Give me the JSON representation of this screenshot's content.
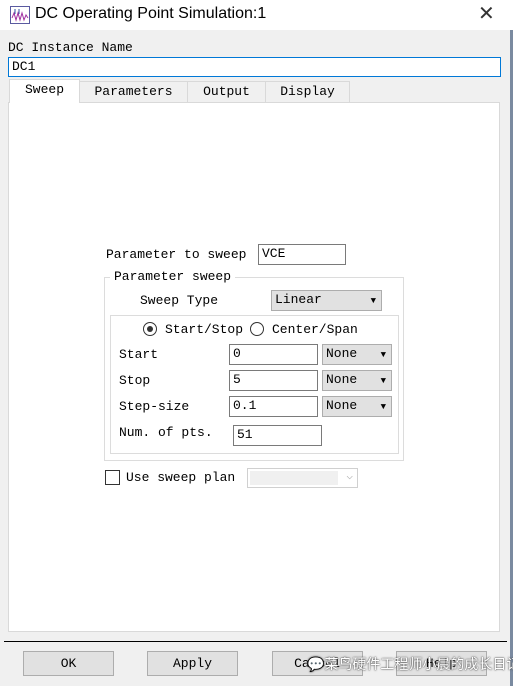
{
  "window": {
    "title": "DC Operating Point Simulation:1",
    "close_icon": "close-icon",
    "app_icon": "waveform-icon"
  },
  "instance": {
    "label": "DC Instance Name",
    "value": "DC1"
  },
  "tabs": [
    {
      "label": "Sweep",
      "selected": true
    },
    {
      "label": "Parameters"
    },
    {
      "label": "Output"
    },
    {
      "label": "Display"
    }
  ],
  "sweep": {
    "param_label": "Parameter to sweep",
    "param_value": "VCE",
    "group_label": "Parameter sweep",
    "type_label": "Sweep Type",
    "type_value": "Linear",
    "mode_options": [
      {
        "label": "Start/Stop",
        "selected": true
      },
      {
        "label": "Center/Span",
        "selected": false
      }
    ],
    "rows": [
      {
        "label": "Start",
        "value": "0",
        "unit": "None"
      },
      {
        "label": "Stop",
        "value": "5",
        "unit": "None"
      },
      {
        "label": "Step-size",
        "value": "0.1",
        "unit": "None"
      }
    ],
    "num_pts_label": "Num. of pts.",
    "num_pts_value": "51",
    "use_plan_label": "Use sweep plan",
    "use_plan_checked": false,
    "plan_value": ""
  },
  "buttons": {
    "ok": "OK",
    "apply": "Apply",
    "cancel": "Cancel",
    "help": "Help"
  },
  "watermark": "菜鸟硬件工程师小晨的成长日记"
}
